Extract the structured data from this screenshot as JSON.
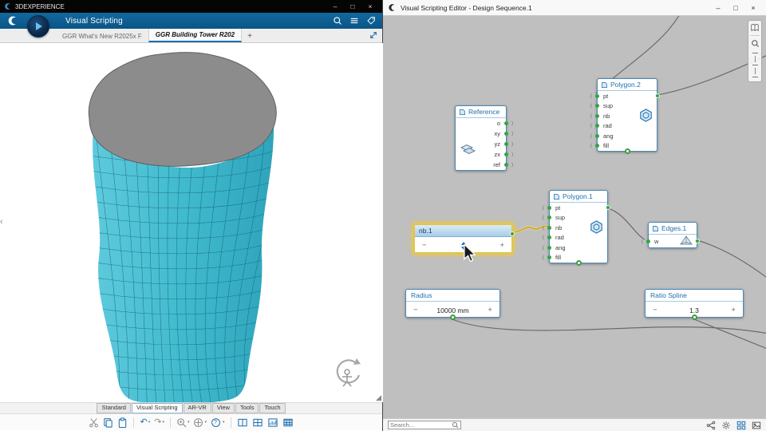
{
  "left": {
    "window_title": "3DEXPERIENCE",
    "app_title": "Visual Scripting",
    "doc_tabs": [
      "GGR What's New R2025x F",
      "GGR Building Tower R202"
    ],
    "add_tab_label": "+",
    "view_tabs": [
      "Standard",
      "Visual Scripting",
      "AR-VR",
      "View",
      "Tools",
      "Touch"
    ],
    "toolbar": {
      "undo": "↶",
      "redo": "↷",
      "help": "?",
      "caret": "▾"
    },
    "viewport": {
      "collapse_chevron": "‹"
    }
  },
  "right": {
    "window_title": "Visual Scripting Editor - Design Sequence.1",
    "search_placeholder": "Search...",
    "nodes": {
      "reference": {
        "title": "Reference",
        "ports": [
          "o",
          "xy",
          "yz",
          "zx",
          "ref"
        ]
      },
      "polygon2": {
        "title": "Polygon.2",
        "ports": [
          "pt",
          "sup",
          "nb",
          "rad",
          "ang",
          "fill"
        ]
      },
      "polygon1": {
        "title": "Polygon.1",
        "ports": [
          "pt",
          "sup",
          "nb",
          "rad",
          "ang",
          "fill"
        ]
      },
      "edges1": {
        "title": "Edges.1",
        "ports": [
          "w"
        ]
      },
      "nb1": {
        "title": "nb.1",
        "minus": "−",
        "plus": "+"
      },
      "radius": {
        "title": "Radius",
        "value": "10000 mm",
        "minus": "−",
        "plus": "+"
      },
      "ratio_spline": {
        "title": "Ratio Spline",
        "value": "1.3",
        "minus": "−",
        "plus": "+"
      }
    }
  },
  "window_controls": {
    "minimize": "–",
    "maximize": "□",
    "close": "×"
  },
  "colors": {
    "accent_blue": "#1f6fae",
    "appbar_blue": "#0e6094",
    "port_green": "#2fa83c",
    "selection_yellow": "#e3c44b",
    "canvas_gray": "#bfbfbf",
    "mesh_cyan": "#49c0d6",
    "cap_gray": "#8c8c8c"
  }
}
